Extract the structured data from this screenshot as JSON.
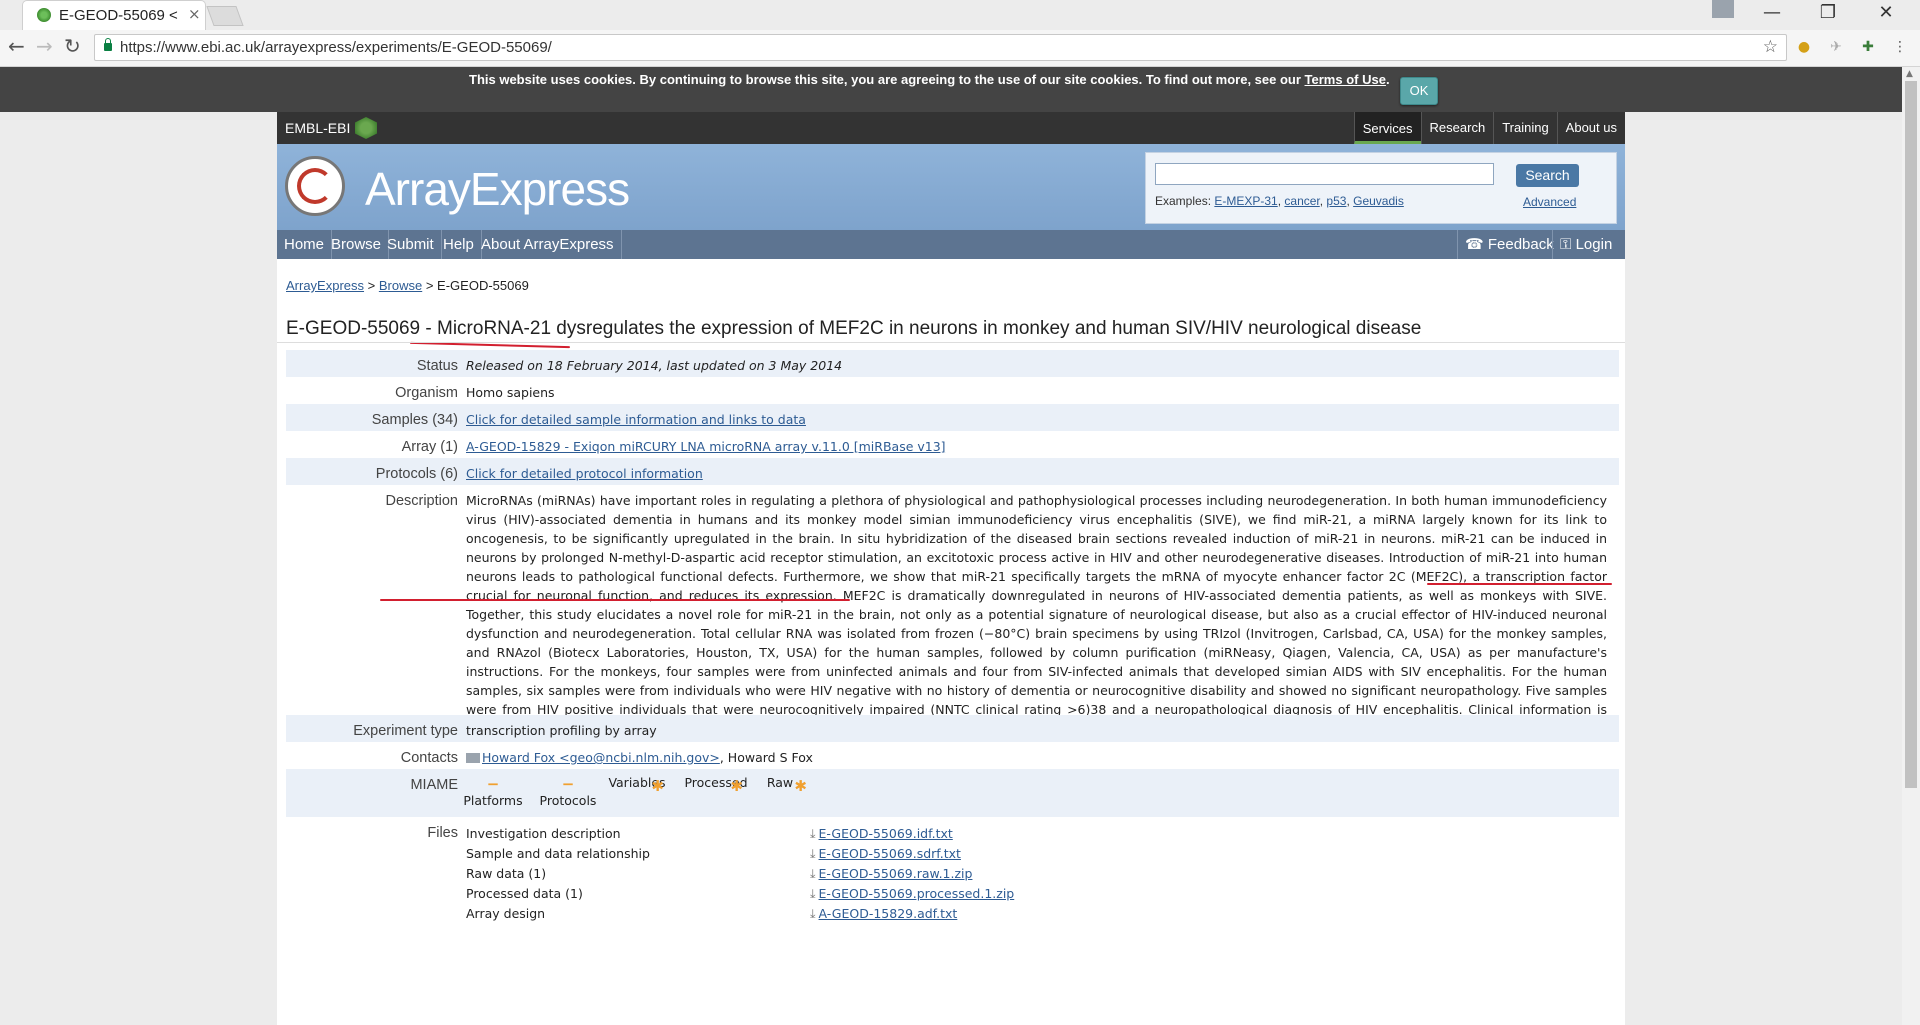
{
  "browser": {
    "tab_title": "E-GEOD-55069 < ",
    "tab_close": "×",
    "url": "https://www.ebi.ac.uk/arrayexpress/experiments/E-GEOD-55069/",
    "window_minimize": "—",
    "window_restore": "❐",
    "window_close": "✕"
  },
  "cookie": {
    "text": "This website uses cookies. By continuing to browse this site, you are agreeing to the use of our site cookies. To find out more, see our ",
    "link": "Terms of Use",
    "suffix": ".",
    "ok": "OK"
  },
  "embl": {
    "logo": "EMBL-EBI",
    "nav": [
      "Services",
      "Research",
      "Training",
      "About us"
    ]
  },
  "header": {
    "title": "ArrayExpress",
    "search_button": "Search",
    "examples_label": "Examples: ",
    "examples": [
      "E-MEXP-31",
      "cancer",
      "p53",
      "Geuvadis"
    ],
    "advanced": "Advanced"
  },
  "localnav": {
    "items": [
      "Home",
      "Browse",
      "Submit",
      "Help",
      "About ArrayExpress"
    ],
    "feedback": "Feedback",
    "login": "Login"
  },
  "breadcrumb": {
    "root": "ArrayExpress",
    "sep": " > ",
    "browse": "Browse",
    "current": "E-GEOD-55069"
  },
  "experiment": {
    "title": "E-GEOD-55069 - MicroRNA-21 dysregulates the expression of MEF2C in neurons in monkey and human SIV/HIV neurological disease",
    "status_label": "Status",
    "status": "Released on 18 February 2014, last updated on 3 May 2014",
    "organism_label": "Organism",
    "organism": "Homo sapiens",
    "samples_label": "Samples (34)",
    "samples": "Click for detailed sample information and links to data",
    "array_label": "Array (1)",
    "array": "A-GEOD-15829 - Exiqon miRCURY LNA microRNA array v.11.0 [miRBase v13]",
    "protocols_label": "Protocols (6)",
    "protocols": "Click for detailed protocol information",
    "description_label": "Description",
    "description": "MicroRNAs (miRNAs) have important roles in regulating a plethora of physiological and pathophysiological processes including neurodegeneration. In both human immunodeficiency virus (HIV)-associated dementia in humans and its monkey model simian immunodeficiency virus encephalitis (SIVE), we find miR-21, a miRNA largely known for its link to oncogenesis, to be significantly upregulated in the brain. In situ hybridization of the diseased brain sections revealed induction of miR-21 in neurons. miR-21 can be induced in neurons by prolonged N-methyl-D-aspartic acid receptor stimulation, an excitotoxic process active in HIV and other neurodegenerative diseases. Introduction of miR-21 into human neurons leads to pathological functional defects. Furthermore, we show that miR-21 specifically targets the mRNA of myocyte enhancer factor 2C (MEF2C), a transcription factor crucial for neuronal function, and reduces its expression. MEF2C is dramatically downregulated in neurons of HIV-associated dementia patients, as well as monkeys with SIVE. Together, this study elucidates a novel role for miR-21 in the brain, not only as a potential signature of neurological disease, but also as a crucial effector of HIV-induced neuronal dysfunction and neurodegeneration. Total cellular RNA was isolated from frozen (−80°C) brain specimens by using TRIzol (Invitrogen, Carlsbad, CA, USA) for the monkey samples, and RNAzol (Biotecx Laboratories, Houston, TX, USA) for the human samples, followed by column purification (miRNeasy, Qiagen, Valencia, CA, USA) as per manufacture's instructions. For the monkeys, four samples were from uninfected animals and four from SIV-infected animals that developed simian AIDS with SIV encephalitis. For the human samples, six samples were from individuals who were HIV negative with no history of dementia or neurocognitive disability and showed no significant neuropathology. Five samples were from HIV positive individuals that were neurocognitively impaired (NNTC clinical rating >6)38 and a neuropathological diagnosis of HIV encephalitis. Clinical information is provided in the supplemental material. For microarray analysis, only three of the HAD specimens were sufficient for use, but all five were used for the qRT-PCR studies.",
    "exptype_label": "Experiment type",
    "exptype": "transcription profiling by array",
    "contacts_label": "Contacts",
    "contact_link": "Howard Fox <geo@ncbi.nlm.nih.gov>",
    "contact_rest": ", Howard S Fox",
    "miame_label": "MIAME",
    "miame": [
      {
        "name": "Platforms",
        "symbol": "−"
      },
      {
        "name": "Protocols",
        "symbol": "−"
      },
      {
        "name": "Variables",
        "symbol": "✱"
      },
      {
        "name": "Processed",
        "symbol": "✱"
      },
      {
        "name": "Raw",
        "symbol": "✱"
      }
    ],
    "files_label": "Files",
    "files": [
      {
        "label": "Investigation description",
        "file": "E-GEOD-55069.idf.txt"
      },
      {
        "label": "Sample and data relationship",
        "file": "E-GEOD-55069.sdrf.txt"
      },
      {
        "label": "Raw data (1)",
        "file": "E-GEOD-55069.raw.1.zip"
      },
      {
        "label": "Processed data (1)",
        "file": "E-GEOD-55069.processed.1.zip"
      },
      {
        "label": "Array design",
        "file": "A-GEOD-15829.adf.txt"
      }
    ]
  },
  "colors": {
    "header_blue": "#8fb3d9",
    "nav_blue": "#5d7491",
    "link": "#2d5b93",
    "row_shade": "#eaf0f8",
    "annotation_red": "#d21f2f"
  }
}
